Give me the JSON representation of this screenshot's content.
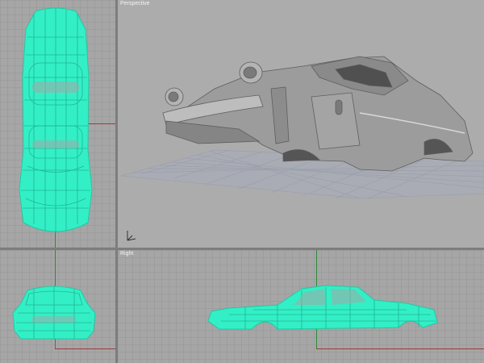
{
  "viewports": {
    "top": {
      "title": ""
    },
    "perspective": {
      "title": "Perspective"
    },
    "front": {
      "title": ""
    },
    "right": {
      "title": "Right"
    }
  },
  "colors": {
    "wireframe": "#33efc6",
    "viewport_bg": "#a6a6a6",
    "perspective_bg": "#acacac",
    "separator": "#7d7d7d",
    "x_axis": "#a03a3a",
    "y_axis": "#2f8a37",
    "model_shade": "#9c9c9c"
  },
  "icons": {
    "axis_gizmo": "axis-gizmo-icon",
    "ground_grid": "ground-plane-grid"
  }
}
